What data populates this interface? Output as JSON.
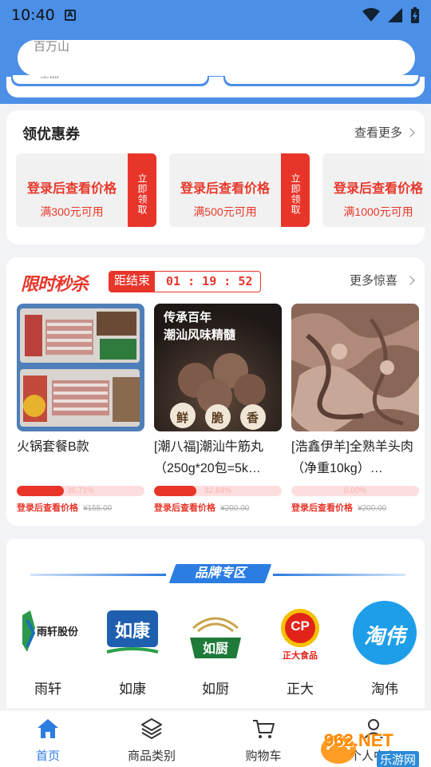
{
  "status_bar": {
    "time": "10:40",
    "notification_letter": "A"
  },
  "search": {
    "placeholder_partial": "百万山",
    "secondary_partial": "王品"
  },
  "coupons": {
    "title": "领优惠券",
    "more": "查看更多",
    "claim_label": "立即领取",
    "items": [
      {
        "title": "登录后查看价格",
        "condition": "满300元可用"
      },
      {
        "title": "登录后查看价格",
        "condition": "满500元可用"
      },
      {
        "title": "登录后查看价格",
        "condition": "满1000元可用"
      }
    ]
  },
  "flash_sale": {
    "logo": "限时秒杀",
    "countdown_label": "距结束",
    "countdown": "01 : 19 : 52",
    "more": "更多惊喜",
    "products": [
      {
        "name": "火锅套餐B款",
        "progress_text": "36.71%",
        "progress": 0.3671,
        "price_login": "登录后查看价格",
        "orig_price": "¥155.00"
      },
      {
        "name": "[潮八福]潮汕牛筋丸（250g*20包=5k…",
        "progress_text": "32.84%",
        "progress": 0.3284,
        "price_login": "登录后查看价格",
        "orig_price": "¥200.00",
        "image_caption_1": "传承百年",
        "image_caption_2": "潮汕风味精髓",
        "badges": [
          "鲜",
          "脆",
          "香"
        ]
      },
      {
        "name": "[浩鑫伊羊]全熟羊头肉（净重10kg）…",
        "progress_text": "0.00%",
        "progress": 0,
        "price_login": "登录后查看价格",
        "orig_price": "¥200.00"
      }
    ]
  },
  "brands": {
    "title": "品牌专区",
    "items": [
      {
        "name": "雨轩",
        "logo_text": "雨轩股份"
      },
      {
        "name": "如康",
        "logo_text": "如康"
      },
      {
        "name": "如厨",
        "logo_text": "如厨"
      },
      {
        "name": "正大",
        "logo_text": "CP",
        "logo_sub": "正大食品"
      },
      {
        "name": "淘伟",
        "logo_text": "淘伟"
      }
    ]
  },
  "bottom_nav": {
    "items": [
      {
        "label": "首页",
        "icon": "home-icon",
        "active": true
      },
      {
        "label": "商品类别",
        "icon": "layers-icon"
      },
      {
        "label": "购物车",
        "icon": "cart-icon"
      },
      {
        "label": "个人中心",
        "icon": "user-icon"
      }
    ]
  },
  "watermark": {
    "text": "962.NET",
    "sub": "乐游网"
  },
  "colors": {
    "brand_blue": "#4b8fe6",
    "accent_red": "#e8352a",
    "nav_active": "#2c7de2"
  }
}
